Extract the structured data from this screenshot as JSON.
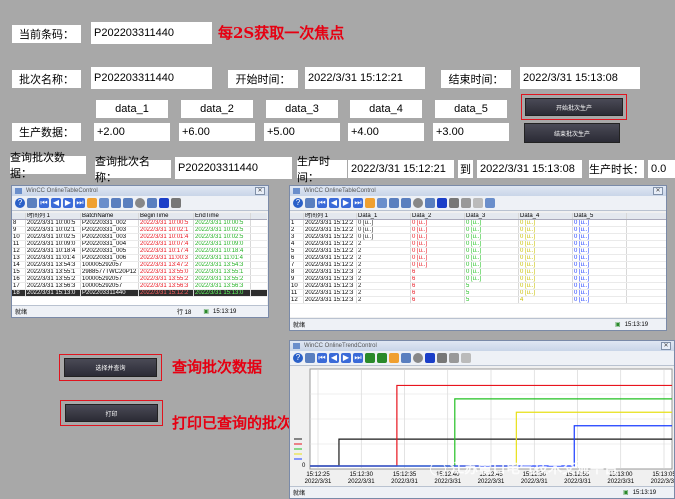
{
  "current_barcode": {
    "label": "当前条码：",
    "value": "P202203311440",
    "note": "每2S获取一次焦点"
  },
  "batch": {
    "name_label": "批次名称：",
    "name_value": "P202203311440",
    "start_label": "开始时间：",
    "start_value": "2022/3/31 15:12:21",
    "end_label": "结束时间：",
    "end_value": "2022/3/31 15:13:08"
  },
  "data_headers": [
    "data_1",
    "data_2",
    "data_3",
    "data_4",
    "data_5"
  ],
  "production_data": {
    "label": "生产数据：",
    "values": [
      "+2.00",
      "+6.00",
      "+5.00",
      "+4.00",
      "+3.00"
    ]
  },
  "buttons": {
    "start_batch": "开始批次生产",
    "end_batch": "结束批次生产",
    "select_query": "选择并查询",
    "print": "打印"
  },
  "query": {
    "label": "查询批次数据：",
    "name_label": "查询批次名称：",
    "name_value": "P202203311440",
    "prod_time_label": "生产时间：",
    "start": "2022/3/31 15:12:21",
    "to": "到",
    "end": "2022/3/31 15:13:08",
    "duration_label": "生产时长：",
    "duration_value": "0.0"
  },
  "annotations": {
    "query_batch": "查询批次数据",
    "print_queried": "打印已查询的批次数据"
  },
  "table1": {
    "title": "WinCC OnlineTableControl",
    "columns": [
      "",
      "时间列 1",
      "BatchName",
      "BeginTime",
      "EndTime"
    ],
    "rows": [
      [
        "8",
        "2022/3/31 10:00:5",
        "P20220331_002",
        "2022/3/31 10:00:5",
        "2022/3/31 10:00:5"
      ],
      [
        "9",
        "2022/3/31 10:02:1",
        "P20220331_003",
        "2022/3/31 10:02:1",
        "2022/3/31 10:02:5"
      ],
      [
        "10",
        "2022/3/31 10:02:5",
        "P20220331_003",
        "2022/3/31 10:01:4",
        "2022/3/31 10:02:5"
      ],
      [
        "11",
        "2022/3/31 10:09:0",
        "P20220331_004",
        "2022/3/31 10:07:4",
        "2022/3/31 10:09:0"
      ],
      [
        "12",
        "2022/3/31 10:18:4",
        "P20220331_005",
        "2022/3/31 10:17:4",
        "2022/3/31 10:18:4"
      ],
      [
        "13",
        "2022/3/31 11:01:4",
        "P20220331_006",
        "2022/3/31 11:00:3",
        "2022/3/31 11:01:4"
      ],
      [
        "14",
        "2022/3/31 13:54:3",
        "100005292057",
        "2022/3/31 13:47:2",
        "2022/3/31 13:54:3"
      ],
      [
        "15",
        "2022/3/31 13:55:1",
        "2988577TWC20P12",
        "2022/3/31 13:55:0",
        "2022/3/31 13:55:1"
      ],
      [
        "16",
        "2022/3/31 13:55:2",
        "100005292057",
        "2022/3/31 13:55:2",
        "2022/3/31 13:55:2"
      ],
      [
        "17",
        "2022/3/31 13:56:3",
        "100005292057",
        "2022/3/31 13:56:3",
        "2022/3/31 13:56:3"
      ],
      [
        "18",
        "2022/3/31 15:13:0",
        "P202203311440",
        "2022/3/31 15:12:2",
        "2022/3/31 15:13:0"
      ]
    ],
    "status_left": "就绪",
    "status_row": "行 18",
    "status_time": "15:13:19"
  },
  "table2": {
    "title": "WinCC OnlineTableControl",
    "columns": [
      "",
      "时间列 1",
      "Data_1",
      "Data_2",
      "Data_3",
      "Data_4",
      "Data_5"
    ],
    "rows": [
      [
        "1",
        "2022/3/31 15:12:2",
        "0 [u..]",
        "0 [u..]",
        "0 [u..]",
        "0 [u..]",
        "0 [u..]"
      ],
      [
        "2",
        "2022/3/31 15:12:2",
        "0 [u..]",
        "0 [u..]",
        "0 [u..]",
        "0 [u..]",
        "0 [u..]"
      ],
      [
        "3",
        "2022/3/31 15:12:2",
        "0 [u..]",
        "0 [u..]",
        "0 [u..]",
        "0 [u..]",
        "0 [u..]"
      ],
      [
        "4",
        "2022/3/31 15:12:2",
        "2",
        "0 [u..]",
        "0 [u..]",
        "0 [u..]",
        "0 [u..]"
      ],
      [
        "5",
        "2022/3/31 15:12:2",
        "2",
        "0 [u..]",
        "0 [u..]",
        "0 [u..]",
        "0 [u..]"
      ],
      [
        "6",
        "2022/3/31 15:12:2",
        "2",
        "0 [u..]",
        "0 [u..]",
        "0 [u..]",
        "0 [u..]"
      ],
      [
        "7",
        "2022/3/31 15:12:2",
        "2",
        "0 [u..]",
        "0 [u..]",
        "0 [u..]",
        "0 [u..]"
      ],
      [
        "8",
        "2022/3/31 15:12:3",
        "2",
        "6",
        "0 [u..]",
        "0 [u..]",
        "0 [u..]"
      ],
      [
        "9",
        "2022/3/31 15:12:3",
        "2",
        "6",
        "0 [u..]",
        "0 [u..]",
        "0 [u..]"
      ],
      [
        "10",
        "2022/3/31 15:12:3",
        "2",
        "6",
        "5",
        "0 [u..]",
        "0 [u..]"
      ],
      [
        "11",
        "2022/3/31 15:12:3",
        "2",
        "6",
        "5",
        "0 [u..]",
        "0 [u..]"
      ],
      [
        "12",
        "2022/3/31 15:12:3",
        "2",
        "6",
        "5",
        "4",
        "0 [u..]"
      ]
    ],
    "status_left": "就绪",
    "status_time": "15:13:19"
  },
  "trend": {
    "title": "WinCC OnlineTrendControl",
    "x_ticks": [
      {
        "t": "15:12:25",
        "d": "2022/3/31"
      },
      {
        "t": "15:12:30",
        "d": "2022/3/31"
      },
      {
        "t": "15:12:35",
        "d": "2022/3/31"
      },
      {
        "t": "15:12:40",
        "d": "2022/3/31"
      },
      {
        "t": "15:12:45",
        "d": "2022/3/31"
      },
      {
        "t": "15:12:50",
        "d": "2022/3/31"
      },
      {
        "t": "15:12:55",
        "d": "2022/3/31"
      },
      {
        "t": "15:13:00",
        "d": "2022/3/31"
      },
      {
        "t": "15:13:05",
        "d": "2022/3/31"
      }
    ],
    "y_left": "0",
    "status_left": "就绪",
    "status_time": "15:13:19"
  },
  "watermark": "江苏雷日电气技术交流平台",
  "colors": {
    "red": "#e60012",
    "series": [
      "#1a1a1a",
      "#e8141e",
      "#22c022",
      "#e8e018",
      "#1a3cff"
    ]
  }
}
